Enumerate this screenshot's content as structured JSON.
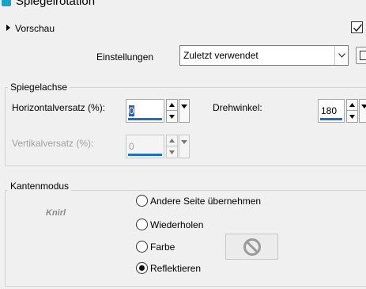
{
  "window": {
    "title": "Spiegelrotation"
  },
  "preview": {
    "label": "Vorschau",
    "checked": true
  },
  "settings": {
    "label": "Einstellungen",
    "value": "Zuletzt verwendet"
  },
  "mirror_axis": {
    "group_label": "Spiegelachse",
    "horizontal_offset": {
      "label": "Horizontalversatz (%):",
      "value": "0"
    },
    "vertical_offset": {
      "label": "Vertikalversatz (%):",
      "value": "0",
      "enabled": false
    },
    "rotation_angle": {
      "label": "Drehwinkel:",
      "value": "180"
    }
  },
  "edge_mode": {
    "group_label": "Kantenmodus",
    "logo_text": "Knirl",
    "options": [
      {
        "label": "Andere Seite übernehmen",
        "selected": false
      },
      {
        "label": "Wiederholen",
        "selected": false
      },
      {
        "label": "Farbe",
        "selected": false
      },
      {
        "label": "Reflektieren",
        "selected": true
      }
    ]
  },
  "colors": {
    "accent": "#1f6fbf",
    "selection": "#2a62c9",
    "background": "#f0f0f0"
  }
}
